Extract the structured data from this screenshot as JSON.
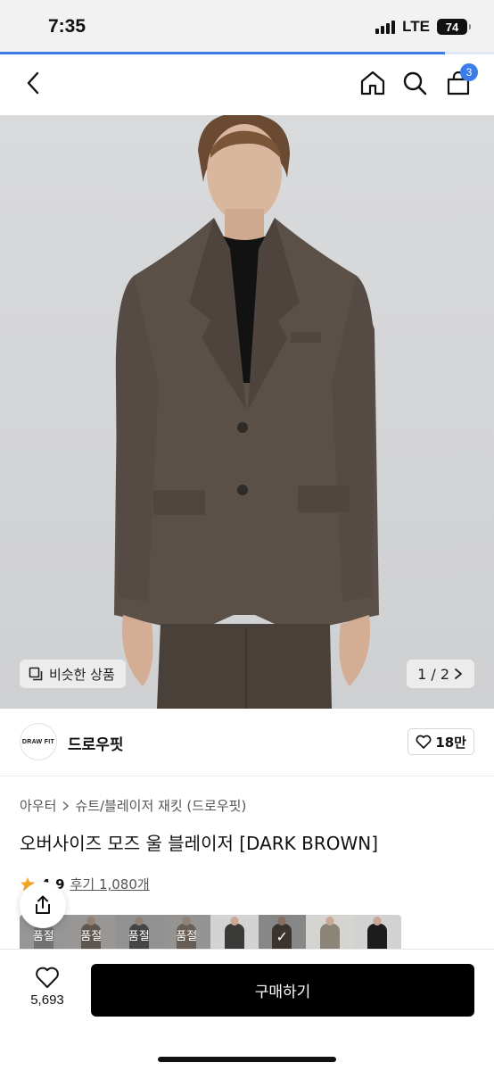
{
  "status_bar": {
    "time": "7:35",
    "network": "LTE",
    "battery": "74",
    "page_load_progress": 0.9
  },
  "nav": {
    "back_icon": "chevron-left-icon",
    "home_icon": "home-icon",
    "search_icon": "search-icon",
    "cart_icon": "shopping-bag-icon",
    "cart_count": "3"
  },
  "hero": {
    "similar_label": "비슷한 상품",
    "page_indicator": "1 / 2",
    "background": "#d6d7d9",
    "jacket_color": "#5b5048"
  },
  "brand": {
    "logo_text": "DRAW FIT",
    "name": "드로우핏",
    "like_count": "18만"
  },
  "product": {
    "breadcrumb": [
      "아우터",
      "슈트/블레이저 재킷 (드로우핏)"
    ],
    "title": "오버사이즈 모즈 울 블레이저 [DARK BROWN]",
    "rating": "4.9",
    "review_label": "후기 1,080개"
  },
  "swatches": [
    {
      "label": "품절",
      "color": "#8e8e8e",
      "sold_out": true
    },
    {
      "label": "품절",
      "color": "#6b5d4f",
      "sold_out": true
    },
    {
      "label": "품절",
      "color": "#3d3d3d",
      "sold_out": true
    },
    {
      "label": "품절",
      "color": "#7a6a5a",
      "sold_out": true
    },
    {
      "label": "",
      "color": "#3a3a38",
      "sold_out": false
    },
    {
      "label": "",
      "color": "#5b5048",
      "sold_out": false,
      "selected": true
    },
    {
      "label": "",
      "color": "#8c8477",
      "sold_out": false
    },
    {
      "label": "",
      "color": "#1c1c1c",
      "sold_out": false
    }
  ],
  "bottom_bar": {
    "wish_count": "5,693",
    "buy_label": "구매하기"
  }
}
